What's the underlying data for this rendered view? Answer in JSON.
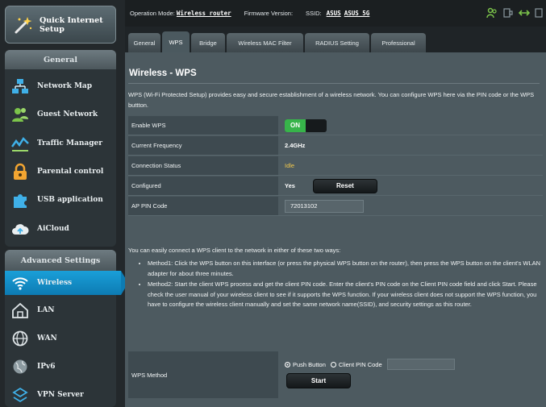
{
  "sidebar": {
    "quick_setup": "Quick Internet Setup",
    "general_header": "General",
    "general_items": [
      {
        "label": "Network Map",
        "icon": "network-map-icon"
      },
      {
        "label": "Guest Network",
        "icon": "guest-network-icon"
      },
      {
        "label": "Traffic Manager",
        "icon": "traffic-manager-icon"
      },
      {
        "label": "Parental control",
        "icon": "lock-icon"
      },
      {
        "label": "USB application",
        "icon": "puzzle-icon"
      },
      {
        "label": "AiCloud",
        "icon": "cloud-icon"
      }
    ],
    "advanced_header": "Advanced Settings",
    "advanced_items": [
      {
        "label": "Wireless",
        "icon": "wifi-icon",
        "active": true
      },
      {
        "label": "LAN",
        "icon": "home-icon"
      },
      {
        "label": "WAN",
        "icon": "globe-icon"
      },
      {
        "label": "IPv6",
        "icon": "ipv6-globe-icon"
      },
      {
        "label": "VPN Server",
        "icon": "vpn-icon"
      }
    ]
  },
  "topbar": {
    "op_mode_label": "Operation Mode:",
    "op_mode_value": "Wireless router",
    "firmware_label": "Firmware Version:",
    "ssid_label": "SSID:",
    "ssid_1": "ASUS",
    "ssid_2": "ASUS_5G"
  },
  "tabs": [
    "General",
    "WPS",
    "Bridge",
    "Wireless MAC Filter",
    "RADIUS Setting",
    "Professional"
  ],
  "active_tab": "WPS",
  "panel": {
    "title": "Wireless - WPS",
    "description": "WPS (Wi-Fi Protected Setup) provides easy and secure establishment of a wireless network. You can configure WPS here via the PIN code or the WPS buttton.",
    "rows": {
      "enable_wps_label": "Enable WPS",
      "enable_wps_value": "ON",
      "frequency_label": "Current Frequency",
      "frequency_value": "2.4GHz",
      "connection_label": "Connection Status",
      "connection_value": "Idle",
      "configured_label": "Configured",
      "configured_value": "Yes",
      "reset_button": "Reset",
      "pin_label": "AP PIN Code",
      "pin_value": "72013102"
    },
    "howto_intro": "You can easily connect a WPS client to the network in either of these two ways:",
    "method1": "Method1: Click the WPS button on this interface (or press the physical WPS button on the router), then press the WPS button on the client's WLAN adapter for about three minutes.",
    "method2": "Method2: Start the client WPS process and get the client PIN code. Enter the client's PIN code on the Client PIN code field and click Start. Please check the user manual of your wireless client to see if it supports the WPS function. If your wireless client does not support the WPS function, you have to configure the wireless client manually and set the same network name(SSID), and security settings as this router.",
    "wps_method_label": "WPS Method",
    "push_button_label": "Push Button",
    "client_pin_label": "Client PIN Code",
    "start_button": "Start"
  },
  "colors": {
    "accent": "#1a9fd8",
    "on_green": "#37b44a",
    "idle_yellow": "#f2c94c",
    "panel_bg": "#4d5a60"
  }
}
